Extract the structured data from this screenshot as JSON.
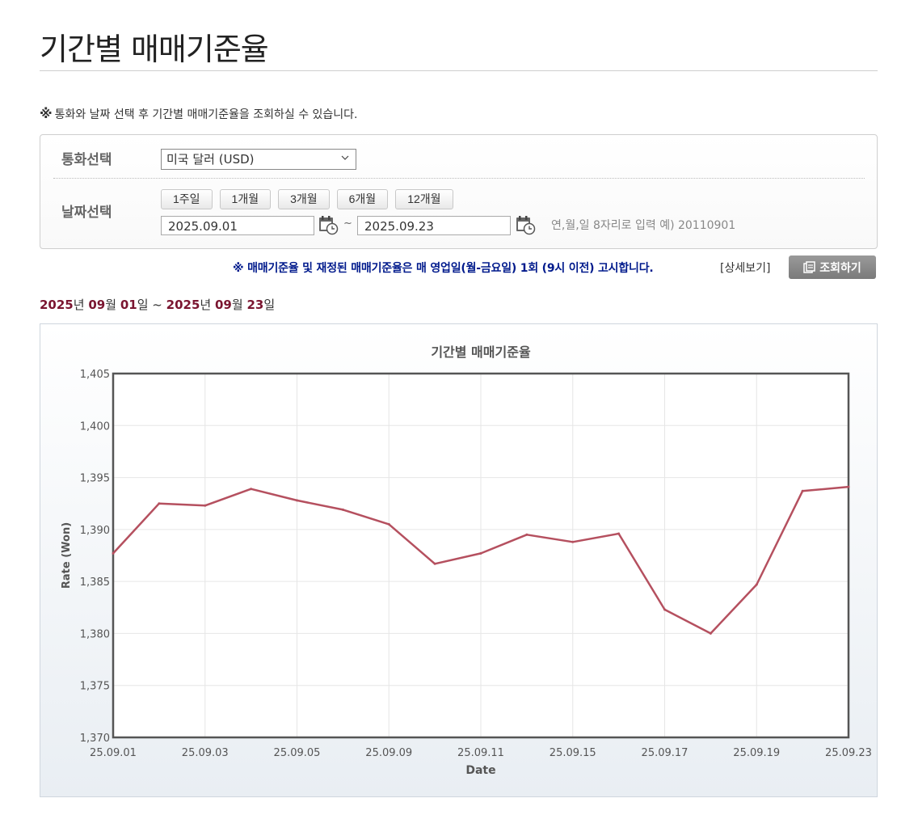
{
  "page": {
    "title": "기간별 매매기준율",
    "notice_mark": "※",
    "notice_text": "통화와 날짜 선택 후 기간별 매매기준율을 조회하실 수 있습니다."
  },
  "form": {
    "currency_label": "통화선택",
    "currency_value": "미국 달러 (USD)",
    "date_label": "날짜선택",
    "period_buttons": [
      "1주일",
      "1개월",
      "3개월",
      "6개월",
      "12개월"
    ],
    "start_date": "2025.09.01",
    "range_sep": "~",
    "end_date": "2025.09.23",
    "date_hint": "연,월,일 8자리로 입력 예) 20110901"
  },
  "announce": {
    "text": "※ 매매기준율 및 재정된 매매기준율은 매 영업일(월-금요일) 1회 (9시 이전) 고시합니다.",
    "detail_link": "[상세보기]",
    "query_button": "조회하기"
  },
  "range": {
    "start_year": "2025",
    "year_unit": "년",
    "start_month": "09",
    "month_unit": "월",
    "start_day": "01",
    "day_unit": "일",
    "tilde": "~",
    "end_year": "2025",
    "end_month": "09",
    "end_day": "23"
  },
  "icons": {
    "select_chevron": "chevron-down-icon",
    "calendar": "calendar-clock-icon",
    "query": "document-list-icon"
  },
  "colors": {
    "line": "#b5505f",
    "range_accent": "#7a1530",
    "notice_blue": "#001a8c"
  },
  "chart_data": {
    "type": "line",
    "title": "기간별 매매기준율",
    "xlabel": "Date",
    "ylabel": "Rate (Won)",
    "ylim": [
      1370,
      1405
    ],
    "yticks": [
      1370,
      1375,
      1380,
      1385,
      1390,
      1395,
      1400,
      1405
    ],
    "ytick_labels": [
      "1,370",
      "1,375",
      "1,380",
      "1,385",
      "1,390",
      "1,395",
      "1,400",
      "1,405"
    ],
    "xtick_labels": [
      "25.09.01",
      "25.09.03",
      "25.09.05",
      "25.09.09",
      "25.09.11",
      "25.09.15",
      "25.09.17",
      "25.09.19",
      "25.09.23"
    ],
    "xtick_index": [
      0,
      2,
      4,
      6,
      8,
      10,
      12,
      14,
      16
    ],
    "grid": true,
    "legend": "none",
    "series": [
      {
        "values": [
          1387.7,
          1392.5,
          1392.3,
          1393.9,
          1392.8,
          1391.9,
          1390.5,
          1386.7,
          1387.7,
          1389.5,
          1388.8,
          1389.6,
          1382.3,
          1380.0,
          1384.7,
          1393.7,
          1394.1
        ]
      }
    ]
  }
}
